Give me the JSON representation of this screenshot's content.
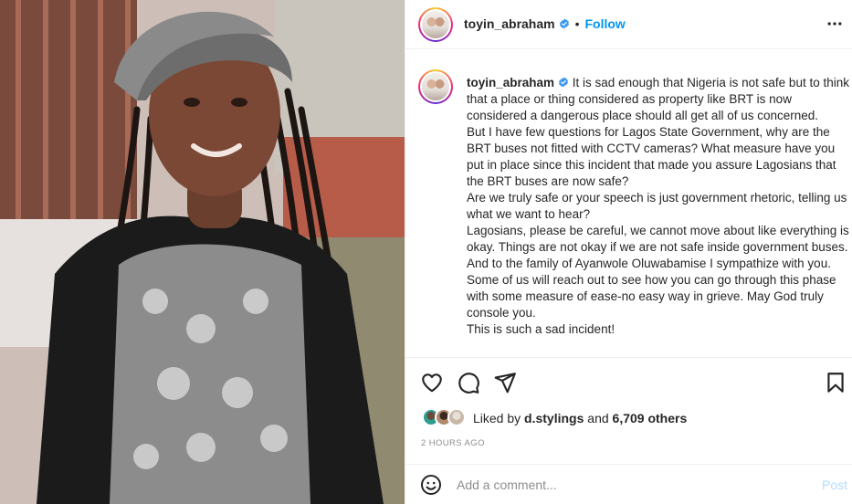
{
  "header": {
    "username": "toyin_abraham",
    "separator": "•",
    "follow_label": "Follow",
    "more_icon": "more-horizontal-icon"
  },
  "caption": {
    "username": "toyin_abraham",
    "text": "It is sad enough that Nigeria is not safe but to think that a place or thing considered as property like BRT is now considered a dangerous place should all get all of us concerned.\nBut I have few questions for Lagos State Government, why are the BRT buses not fitted with CCTV cameras? What measure have you put in place since this incident that made you assure Lagosians that the BRT buses are now safe?\nAre we truly safe or your speech is just government rhetoric, telling us what we want to hear?\nLagosians, please be careful, we cannot move about like everything is okay. Things are not okay if we are not safe inside government buses.\nAnd to the family of Ayanwole Oluwabamise I sympathize with you. Some of us will reach out to see how you can go through this phase with some measure of ease-no easy way in grieve. May God truly console you.\nThis is such a sad incident!"
  },
  "actions": {
    "icons": [
      "heart-icon",
      "comment-icon",
      "share-icon",
      "bookmark-icon"
    ]
  },
  "likes": {
    "prefix": "Liked by ",
    "liker": "d.stylings",
    "joiner": " and ",
    "others": "6,709 others"
  },
  "timestamp": "2 HOURS AGO",
  "comment": {
    "placeholder": "Add a comment...",
    "post_label": "Post",
    "emoji_icon": "emoji-icon"
  },
  "colors": {
    "accent": "#0095f6",
    "verified": "#3897f0",
    "post_disabled": "#b3dbff",
    "muted": "#8e8e8e"
  }
}
